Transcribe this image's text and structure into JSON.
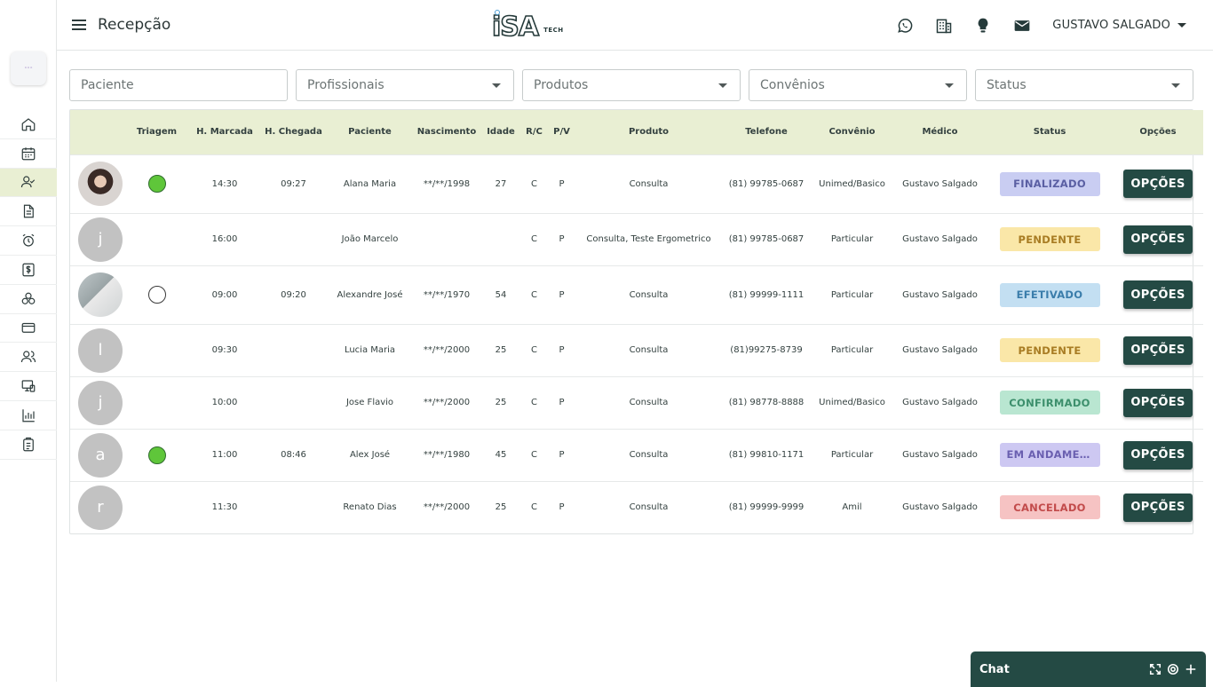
{
  "header": {
    "title": "Recepção",
    "brand": "iSA",
    "brand_suffix": "TECH",
    "user_name": "GUSTAVO SALGADO"
  },
  "filters": {
    "patient_placeholder": "Paciente",
    "professionals": "Profissionais",
    "products": "Produtos",
    "insurances": "Convênios",
    "status": "Status"
  },
  "table": {
    "headers": [
      "",
      "Triagem",
      "H. Marcada",
      "H. Chegada",
      "Paciente",
      "Nascimento",
      "Idade",
      "R/C",
      "P/V",
      "Produto",
      "Telefone",
      "Convênio",
      "Médico",
      "Status",
      "Opções"
    ],
    "rows": [
      {
        "avatar": "",
        "triage": "green",
        "scheduled": "14:30",
        "arrival": "09:27",
        "patient": "Alana Maria",
        "birth": "**/**/1998",
        "age": "27",
        "rc": "C",
        "pv": "P",
        "product": "Consulta",
        "phone": "(81) 99785-0687",
        "insurance": "Unimed/Basico",
        "doctor": "Gustavo Salgado",
        "status": "FINALIZADO",
        "status_kind": "finalizado",
        "options": "OPÇÕES"
      },
      {
        "avatar": "j",
        "triage": "",
        "scheduled": "16:00",
        "arrival": "",
        "patient": "João Marcelo",
        "birth": "",
        "age": "",
        "rc": "C",
        "pv": "P",
        "product": "Consulta, Teste Ergometrico",
        "phone": "(81) 99785-0687",
        "insurance": "Particular",
        "doctor": "Gustavo Salgado",
        "status": "PENDENTE",
        "status_kind": "pendente",
        "options": "OPÇÕES"
      },
      {
        "avatar": "",
        "triage": "empty",
        "scheduled": "09:00",
        "arrival": "09:20",
        "patient": "Alexandre José",
        "birth": "**/**/1970",
        "age": "54",
        "rc": "C",
        "pv": "P",
        "product": "Consulta",
        "phone": "(81) 99999-1111",
        "insurance": "Particular",
        "doctor": "Gustavo Salgado",
        "status": "EFETIVADO",
        "status_kind": "efetivado",
        "options": "OPÇÕES"
      },
      {
        "avatar": "l",
        "triage": "",
        "scheduled": "09:30",
        "arrival": "",
        "patient": "Lucia Maria",
        "birth": "**/**/2000",
        "age": "25",
        "rc": "C",
        "pv": "P",
        "product": "Consulta",
        "phone": "(81)99275-8739",
        "insurance": "Particular",
        "doctor": "Gustavo Salgado",
        "status": "PENDENTE",
        "status_kind": "pendente",
        "options": "OPÇÕES"
      },
      {
        "avatar": "j",
        "triage": "",
        "scheduled": "10:00",
        "arrival": "",
        "patient": "Jose Flavio",
        "birth": "**/**/2000",
        "age": "25",
        "rc": "C",
        "pv": "P",
        "product": "Consulta",
        "phone": "(81) 98778-8888",
        "insurance": "Unimed/Basico",
        "doctor": "Gustavo Salgado",
        "status": "CONFIRMADO",
        "status_kind": "confirmado",
        "options": "OPÇÕES"
      },
      {
        "avatar": "a",
        "triage": "green",
        "scheduled": "11:00",
        "arrival": "08:46",
        "patient": "Alex José",
        "birth": "**/**/1980",
        "age": "45",
        "rc": "C",
        "pv": "P",
        "product": "Consulta",
        "phone": "(81) 99810-1171",
        "insurance": "Particular",
        "doctor": "Gustavo Salgado",
        "status": "EM ANDAMEN...",
        "status_kind": "andamento",
        "options": "OPÇÕES"
      },
      {
        "avatar": "r",
        "triage": "",
        "scheduled": "11:30",
        "arrival": "",
        "patient": "Renato Dias",
        "birth": "**/**/2000",
        "age": "25",
        "rc": "C",
        "pv": "P",
        "product": "Consulta",
        "phone": "(81) 99999-9999",
        "insurance": "Amil",
        "doctor": "Gustavo Salgado",
        "status": "CANCELADO",
        "status_kind": "cancelado",
        "options": "OPÇÕES"
      }
    ]
  },
  "chat": {
    "title": "Chat"
  },
  "colors": {
    "primary": "#244a44",
    "header_row": "#e9efd3",
    "triage_green": "#5fc63a"
  }
}
